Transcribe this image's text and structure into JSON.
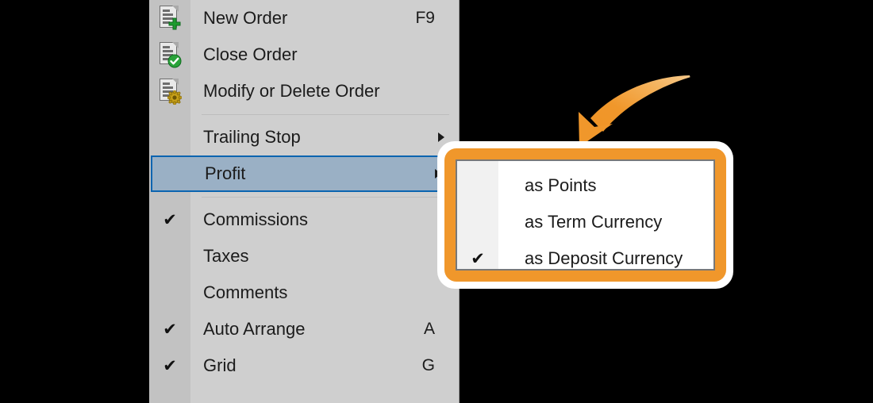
{
  "colors": {
    "menu_background": "#cfcfcf",
    "menu_gutter": "#c2c2c2",
    "selection_fill": "#9ab0c5",
    "selection_border": "#0a64b0",
    "highlight_ring": "#f0972b",
    "annotation_arrow": "#f0972b",
    "text": "#1b1b1b",
    "canvas": "#000000",
    "submenu_background": "#ffffff",
    "submenu_gutter": "#f1f1f1",
    "submenu_border": "#787878"
  },
  "context_menu": {
    "items": [
      {
        "label": "New Order",
        "accel": "F9",
        "icon": "document-add-icon",
        "checked": false,
        "selected": false,
        "has_submenu": false
      },
      {
        "label": "Close Order",
        "accel": "",
        "icon": "document-check-icon",
        "checked": false,
        "selected": false,
        "has_submenu": false
      },
      {
        "label": "Modify or Delete Order",
        "accel": "",
        "icon": "document-gear-icon",
        "checked": false,
        "selected": false,
        "has_submenu": false
      },
      {
        "separator": true
      },
      {
        "label": "Trailing Stop",
        "accel": "",
        "icon": "",
        "checked": false,
        "selected": false,
        "has_submenu": true
      },
      {
        "label": "Profit",
        "accel": "",
        "icon": "",
        "checked": false,
        "selected": true,
        "has_submenu": true
      },
      {
        "separator": true
      },
      {
        "label": "Commissions",
        "accel": "",
        "icon": "",
        "checked": true,
        "selected": false,
        "has_submenu": false
      },
      {
        "label": "Taxes",
        "accel": "",
        "icon": "",
        "checked": false,
        "selected": false,
        "has_submenu": false
      },
      {
        "label": "Comments",
        "accel": "",
        "icon": "",
        "checked": false,
        "selected": false,
        "has_submenu": false
      },
      {
        "label": "Auto Arrange",
        "accel": "A",
        "icon": "",
        "checked": true,
        "selected": false,
        "has_submenu": false
      },
      {
        "label": "Grid",
        "accel": "G",
        "icon": "",
        "checked": true,
        "selected": false,
        "has_submenu": false
      }
    ]
  },
  "submenu": {
    "parent_item": "Profit",
    "items": [
      {
        "label": "as Points",
        "checked": false
      },
      {
        "label": "as Term Currency",
        "checked": false
      },
      {
        "label": "as Deposit Currency",
        "checked": true
      }
    ]
  },
  "annotation": {
    "arrow_name": "curved-arrow-pointing-to-submenu",
    "check_glyph": "✔"
  }
}
